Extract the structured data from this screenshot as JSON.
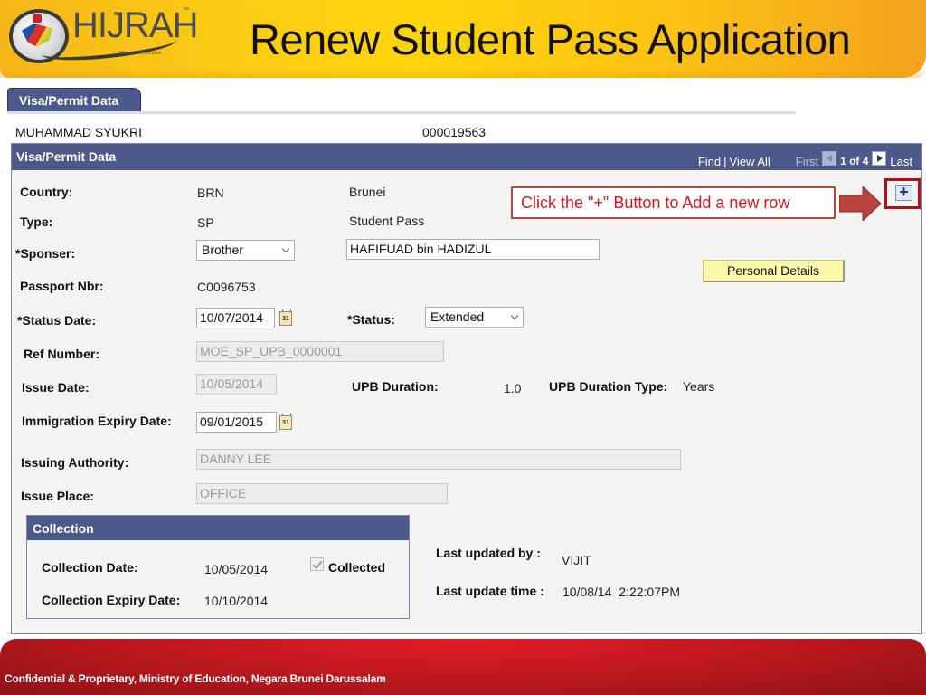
{
  "header": {
    "logo_text": "HIJRAH",
    "logo_tm": "™",
    "logo_tagline": "Ministry of Education",
    "title": "Renew Student Pass Application"
  },
  "tab": {
    "label": "Visa/Permit Data"
  },
  "person": {
    "name": "MUHAMMAD SYUKRI",
    "id": "000019563"
  },
  "panel": {
    "title": "Visa/Permit Data",
    "nav": {
      "find": "Find",
      "separator": "|",
      "view_all": "View All",
      "first": "First",
      "count": "1 of 4",
      "last": "Last"
    }
  },
  "fields": {
    "country": {
      "label": "Country:",
      "code": "BRN",
      "name": "Brunei"
    },
    "type": {
      "label": "Type:",
      "code": "SP",
      "name": "Student Pass"
    },
    "sponser": {
      "label": "*Sponser:",
      "value": "Brother",
      "name_value": "HAFIFUAD bin HADIZUL"
    },
    "passport": {
      "label": "Passport Nbr:",
      "value": "C0096753"
    },
    "status_date": {
      "label": "*Status Date:",
      "value": "10/07/2014"
    },
    "status": {
      "label": "*Status:",
      "value": "Extended"
    },
    "ref_number": {
      "label": "Ref Number:",
      "value": "MOE_SP_UPB_0000001"
    },
    "issue_date": {
      "label": "Issue Date:",
      "value": "10/05/2014"
    },
    "upb_duration": {
      "label": "UPB Duration:",
      "value": "1.0"
    },
    "upb_duration_type": {
      "label": "UPB Duration Type:",
      "value": "Years"
    },
    "immigration_expiry": {
      "label": "Immigration Expiry Date:",
      "value": "09/01/2015"
    },
    "issuing_authority": {
      "label": "Issuing Authority:",
      "value": "DANNY LEE"
    },
    "issue_place": {
      "label": "Issue Place:",
      "value": "OFFICE"
    }
  },
  "calendar_icon_text": "31",
  "personal_details_button": "Personal Details",
  "callout": {
    "text": "Click the \"+\" Button to Add a new row"
  },
  "add_row_button": "+",
  "collection": {
    "title": "Collection",
    "collection_date": {
      "label": "Collection Date:",
      "value": "10/05/2014"
    },
    "collected": {
      "label": "Collected",
      "checked": true
    },
    "collection_expiry": {
      "label": "Collection Expiry Date:",
      "value": "10/10/2014"
    }
  },
  "audit": {
    "last_updated_by": {
      "label": "Last updated by :",
      "value": "VIJIT"
    },
    "last_update_time": {
      "label": "Last update time :",
      "value": "10/08/14  2:22:07PM"
    }
  },
  "footer": {
    "text": "Confidential & Proprietary, Ministry of Education, Negara Brunei Darussalam"
  },
  "colors": {
    "header_blue": "#4b5a8b",
    "callout_red": "#d6151b",
    "banner_yellow": "#fdd50a",
    "footer_red": "#c0191f"
  }
}
